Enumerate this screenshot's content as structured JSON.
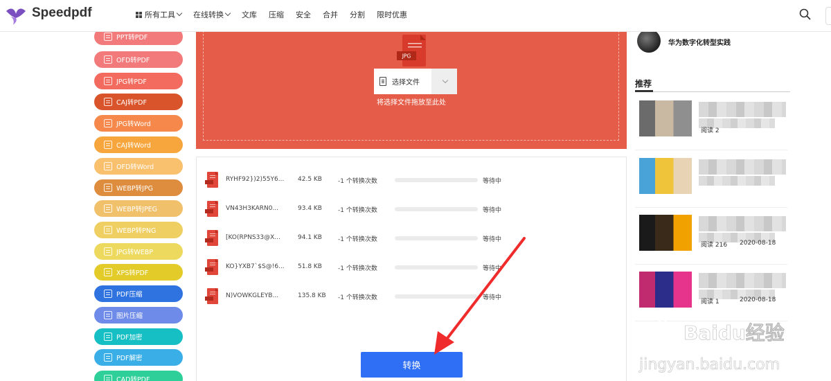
{
  "brand": {
    "name": "Speedpdf"
  },
  "nav": {
    "items": [
      {
        "label": "所有工具",
        "has_dropdown": true,
        "icon": "grid-icon"
      },
      {
        "label": "在线转换",
        "has_dropdown": true
      },
      {
        "label": "文库"
      },
      {
        "label": "压缩"
      },
      {
        "label": "安全"
      },
      {
        "label": "合并"
      },
      {
        "label": "分割"
      },
      {
        "label": "限时优惠"
      }
    ]
  },
  "sidebar": {
    "tools": [
      {
        "label": "PPT转PDF",
        "color": "#f27a7a"
      },
      {
        "label": "OFD转PDF",
        "color": "#f27a7a"
      },
      {
        "label": "JPG转PDF",
        "color": "#f26b5e"
      },
      {
        "label": "CAJ转PDF",
        "color": "#d9542b"
      },
      {
        "label": "JPG转Word",
        "color": "#f5884a"
      },
      {
        "label": "CAJ转Word",
        "color": "#f7a63d"
      },
      {
        "label": "OFD转Word",
        "color": "#f9c06e"
      },
      {
        "label": "WEBP转JPG",
        "color": "#de8c3e"
      },
      {
        "label": "WEBP转JPEG",
        "color": "#f0c06a"
      },
      {
        "label": "WEBP转PNG",
        "color": "#f0cf62"
      },
      {
        "label": "JPG转WEBP",
        "color": "#ecd95e"
      },
      {
        "label": "XPS转PDF",
        "color": "#e3cc2a"
      },
      {
        "label": "PDF压缩",
        "color": "#2f73e0"
      },
      {
        "label": "图片压缩",
        "color": "#6f8bea"
      },
      {
        "label": "PDF加密",
        "color": "#16bfc4"
      },
      {
        "label": "PDF解密",
        "color": "#3aaee6"
      },
      {
        "label": "CAD转PDF",
        "color": "#2fcf9a"
      }
    ]
  },
  "upload": {
    "file_type_badge": "JPG",
    "select_button_label": "选择文件",
    "drop_hint": "将选择文件拖放至此处",
    "background_color": "#e55c48"
  },
  "files": [
    {
      "name": "RYHF92})2)55Y6...",
      "size": "42.5 KB",
      "count": "-1 个转换次数",
      "status": "等待中",
      "progress": 0
    },
    {
      "name": "VN43H3KARN0...",
      "size": "93.4 KB",
      "count": "-1 个转换次数",
      "status": "等待中",
      "progress": 0
    },
    {
      "name": "[KO(RPNS33@X...",
      "size": "94.1 KB",
      "count": "-1 个转换次数",
      "status": "等待中",
      "progress": 0
    },
    {
      "name": "KO}YXB7`$S@!6...",
      "size": "51.8 KB",
      "count": "-1 个转换次数",
      "status": "等待中",
      "progress": 0
    },
    {
      "name": "N)VOWKGLEYB...",
      "size": "135.8 KB",
      "count": "-1 个转换次数",
      "status": "等待中",
      "progress": 0
    }
  ],
  "convert_button": {
    "label": "转换",
    "color": "#2f6ff5"
  },
  "right": {
    "author_title": "华为数字化转型实践",
    "recommend_heading": "推荐",
    "items": [
      {
        "meta": "阅读 2",
        "date": "",
        "thumb": [
          "#6b6b6b",
          "#c9b9a2",
          "#8f8f8f"
        ]
      },
      {
        "meta": "",
        "date": "",
        "thumb": [
          "#4aa3d8",
          "#f0c43a",
          "#e9d3b5"
        ]
      },
      {
        "meta": "阅读 216",
        "date": "2020-08-18",
        "thumb": [
          "#1a1a1a",
          "#3a2a1a",
          "#f2a200"
        ]
      },
      {
        "meta": "阅读 1",
        "date": "2020-08-18",
        "thumb": [
          "#c02a6e",
          "#2c2c8a",
          "#e6338c"
        ]
      }
    ]
  },
  "watermark": {
    "text1": "Baidu经验",
    "text2": "jingyan.baidu.com"
  }
}
